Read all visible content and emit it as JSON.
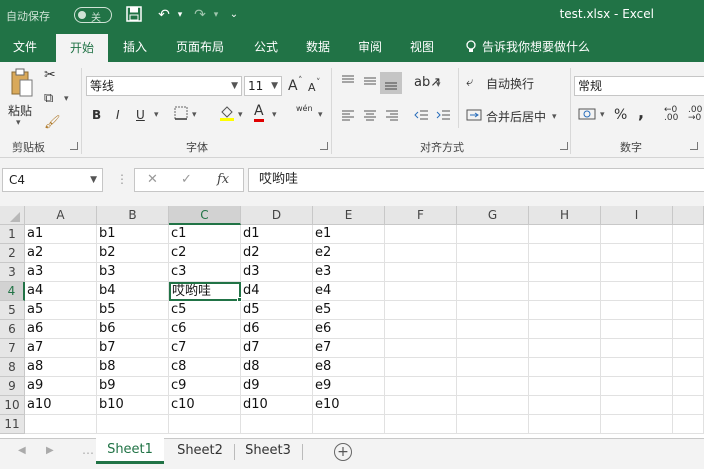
{
  "titlebar": {
    "autosave_label": "自动保存",
    "autosave_state": "关",
    "title": "test.xlsx  -  Excel",
    "save_icon": "save-icon",
    "undo_icon": "undo-icon",
    "redo_icon": "redo-icon"
  },
  "tabs": [
    "文件",
    "开始",
    "插入",
    "页面布局",
    "公式",
    "数据",
    "审阅",
    "视图"
  ],
  "tellme": "告诉我你想要做什么",
  "ribbon": {
    "clipboard": {
      "label": "剪贴板",
      "paste": "粘贴"
    },
    "font": {
      "label": "字体",
      "name": "等线",
      "size": "11",
      "bold": "B",
      "italic": "I",
      "underline": "U",
      "grow": "A",
      "shrink": "A",
      "wen": "wén",
      "font_color": "A"
    },
    "alignment": {
      "label": "对齐方式",
      "wrap": "自动换行",
      "merge": "合并后居中"
    },
    "number": {
      "label": "数字",
      "format": "常规",
      "percent": "%",
      "comma": ","
    }
  },
  "formula_bar": {
    "name_box": "C4",
    "fx": "fx",
    "cancel": "✕",
    "enter": "✓",
    "value": "哎哟哇"
  },
  "columns": [
    "A",
    "B",
    "C",
    "D",
    "E",
    "F",
    "G",
    "H",
    "I"
  ],
  "rows": [
    "1",
    "2",
    "3",
    "4",
    "5",
    "6",
    "7",
    "8",
    "9",
    "10",
    "11"
  ],
  "cells": [
    [
      "a1",
      "b1",
      "c1",
      "d1",
      "e1"
    ],
    [
      "a2",
      "b2",
      "c2",
      "d2",
      "e2"
    ],
    [
      "a3",
      "b3",
      "c3",
      "d3",
      "e3"
    ],
    [
      "a4",
      "b4",
      "哎哟哇",
      "d4",
      "e4"
    ],
    [
      "a5",
      "b5",
      "c5",
      "d5",
      "e5"
    ],
    [
      "a6",
      "b6",
      "c6",
      "d6",
      "e6"
    ],
    [
      "a7",
      "b7",
      "c7",
      "d7",
      "e7"
    ],
    [
      "a8",
      "b8",
      "c8",
      "d8",
      "e8"
    ],
    [
      "a9",
      "b9",
      "c9",
      "d9",
      "e9"
    ],
    [
      "a10",
      "b10",
      "c10",
      "d10",
      "e10"
    ],
    [
      "",
      "",
      "",
      "",
      ""
    ]
  ],
  "active_cell": {
    "col": "C",
    "row": "4"
  },
  "sheets": [
    "Sheet1",
    "Sheet2",
    "Sheet3"
  ],
  "active_sheet": "Sheet1",
  "colors": {
    "accent": "#217346",
    "fill_highlight": "#ffff00",
    "font_color_bar": "#e00000"
  }
}
